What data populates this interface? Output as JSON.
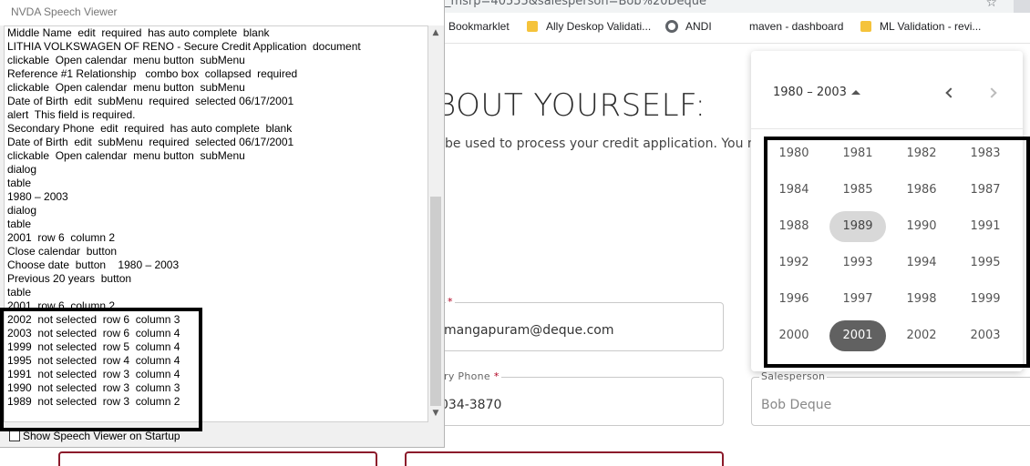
{
  "browser": {
    "url": "_msrp=40555&salesperson=Bob%20Deque",
    "bookmarks": [
      {
        "label": "Bookmarklet",
        "icon": "none"
      },
      {
        "label": "Ally Deskop Validati...",
        "icon": "folder-icon"
      },
      {
        "label": "ANDI",
        "icon": "globe-icon"
      },
      {
        "label": "maven - dashboard",
        "icon": "none"
      },
      {
        "label": "ML Validation - revi...",
        "icon": "folder-icon"
      }
    ]
  },
  "page": {
    "heading": "BOUT YOURSELF:",
    "subtext": "be used to process your credit application. You may",
    "email": {
      "label_required": "*",
      "value": "mangapuram@deque.com"
    },
    "phone": {
      "label": "ry Phone",
      "label_required": "*",
      "value": "034-3870"
    },
    "salesperson": {
      "label": "Salesperson",
      "value": "Bob Deque"
    }
  },
  "year_picker": {
    "range_label": "1980 – 2003",
    "years": [
      "1980",
      "1981",
      "1982",
      "1983",
      "1984",
      "1985",
      "1986",
      "1987",
      "1988",
      "1989",
      "1990",
      "1991",
      "1992",
      "1993",
      "1994",
      "1995",
      "1996",
      "1997",
      "1998",
      "1999",
      "2000",
      "2001",
      "2002",
      "2003"
    ],
    "hovered_year": "1989",
    "selected_year": "2001"
  },
  "speech_viewer": {
    "title": "NVDA Speech Viewer",
    "lines": [
      "Middle Name  edit  required  has auto complete  blank",
      "LITHIA VOLKSWAGEN OF RENO - Secure Credit Application  document",
      "clickable  Open calendar  menu button  subMenu",
      "Reference #1 Relationship   combo box  collapsed  required",
      "clickable  Open calendar  menu button  subMenu",
      "Date of Birth  edit  subMenu  required  selected 06/17/2001",
      "alert  This field is required.",
      "Secondary Phone  edit  required  has auto complete  blank",
      "Date of Birth  edit  subMenu  required  selected 06/17/2001",
      "clickable  Open calendar  menu button  subMenu",
      "dialog",
      "table",
      "1980 – 2003",
      "dialog",
      "table",
      "2001  row 6  column 2",
      "Close calendar  button",
      "Choose date  button    1980 – 2003",
      "Previous 20 years  button",
      "table",
      "2001  row 6  column 2",
      "2002  not selected  row 6  column 3",
      "2003  not selected  row 6  column 4",
      "1999  not selected  row 5  column 4",
      "1995  not selected  row 4  column 4",
      "1991  not selected  row 3  column 4",
      "1990  not selected  row 3  column 3",
      "1989  not selected  row 3  column 2"
    ],
    "startup_label": "Show Speech Viewer on Startup",
    "startup_checked": false
  }
}
